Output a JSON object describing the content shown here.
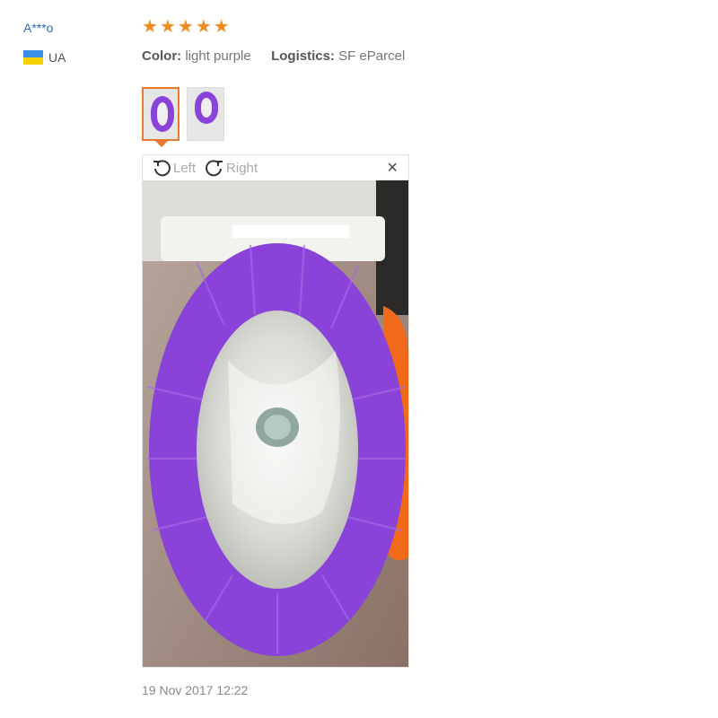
{
  "reviewer": {
    "name": "A***o",
    "country_code": "UA",
    "flag_colors": [
      "#3a8ee6",
      "#f5d000"
    ]
  },
  "review": {
    "rating": 5,
    "max_rating": 5,
    "star_color": "#f08a1c",
    "color_label": "Color:",
    "color_value": "light purple",
    "logistics_label": "Logistics:",
    "logistics_value": "SF eParcel",
    "date": "19 Nov 2017 12:22"
  },
  "viewer": {
    "rotate_left_label": "Left",
    "rotate_right_label": "Right",
    "close_label": "×",
    "icons": {
      "rotate_left": "rotate-left-icon",
      "rotate_right": "rotate-right-icon",
      "close": "close-icon"
    }
  },
  "thumbnails": [
    "review-photo-1",
    "review-photo-2"
  ],
  "accent_color": "#e77a2f",
  "product_color": "#8a43d8"
}
